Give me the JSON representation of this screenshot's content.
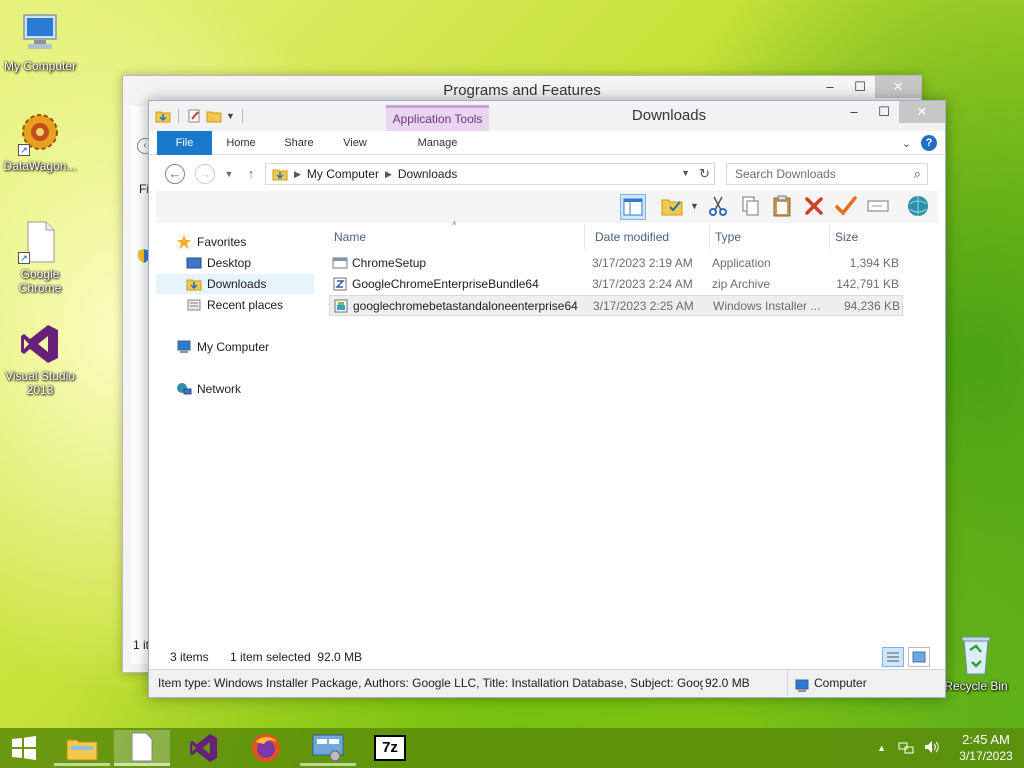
{
  "desktop": {
    "icons": [
      {
        "label": "My Computer"
      },
      {
        "label": "DataWagon..."
      },
      {
        "label": "Google Chrome"
      },
      {
        "label": "Visual Studio 2013"
      },
      {
        "label": "Recycle Bin"
      }
    ]
  },
  "background_window": {
    "title": "Programs and Features",
    "side_text": "Fi",
    "bottom_text": "1 it"
  },
  "window": {
    "title": "Downloads",
    "contextual_tab": "Application Tools",
    "ribbon_tabs": {
      "file": "File",
      "home": "Home",
      "share": "Share",
      "view": "View",
      "manage": "Manage"
    },
    "address": {
      "crumbs": [
        "My Computer",
        "Downloads"
      ]
    },
    "search": {
      "placeholder": "Search Downloads"
    },
    "nav": {
      "favorites": "Favorites",
      "desktop": "Desktop",
      "downloads": "Downloads",
      "recent": "Recent places",
      "computer": "My Computer",
      "network": "Network"
    },
    "columns": {
      "name": "Name",
      "date": "Date modified",
      "type": "Type",
      "size": "Size"
    },
    "files": [
      {
        "name": "ChromeSetup",
        "date": "3/17/2023 2:19 AM",
        "type": "Application",
        "size": "1,394 KB"
      },
      {
        "name": "GoogleChromeEnterpriseBundle64",
        "date": "3/17/2023 2:24 AM",
        "type": "zip Archive",
        "size": "142,791 KB"
      },
      {
        "name": "googlechromebetastandaloneenterprise64",
        "date": "3/17/2023 2:25 AM",
        "type": "Windows Installer ...",
        "size": "94,236 KB"
      }
    ],
    "status": {
      "count": "3 items",
      "selected": "1 item selected  92.0 MB"
    },
    "details": {
      "info": "Item type: Windows Installer Package, Authors: Google LLC, Title: Installation Database, Subject: Google",
      "size": "92.0 MB",
      "location": "Computer"
    }
  },
  "taskbar": {
    "time": "2:45 AM",
    "date": "3/17/2023",
    "sevenzip_label": "7z"
  },
  "colors": {
    "accent": "#1979ca",
    "context_tab": "#ead5f1",
    "selection": "#cde6fb"
  }
}
